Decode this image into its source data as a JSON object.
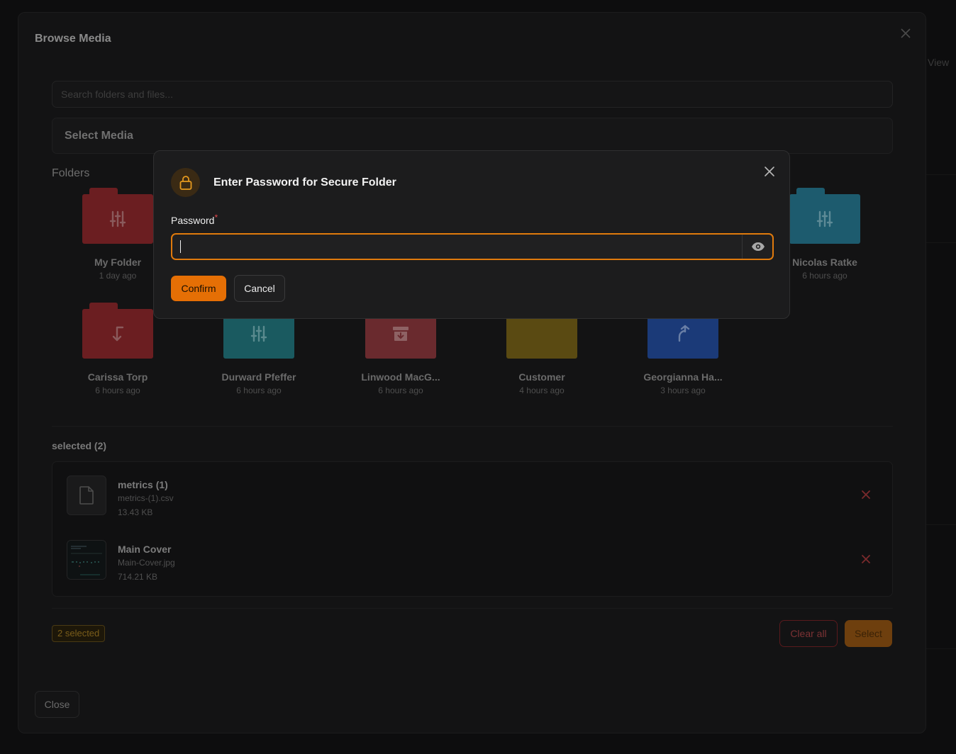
{
  "background": {
    "view_label": "View"
  },
  "outer_modal": {
    "title": "Browse Media",
    "search_placeholder": "Search folders and files...",
    "select_media_title": "Select Media",
    "folders_heading": "Folders"
  },
  "folders": [
    {
      "name": "My Folder",
      "time": "1 day ago",
      "color": "#6b1e21",
      "icon": "sliders-icon"
    },
    {
      "name": "Nicolas Ratke",
      "time": "6 hours ago",
      "color": "#1d5b6e",
      "icon": "sliders-icon"
    },
    {
      "name": "Carissa Torp",
      "time": "6 hours ago",
      "color": "#6b1e21",
      "icon": "arrow-down-left-icon"
    },
    {
      "name": "Durward Pfeffer",
      "time": "6 hours ago",
      "color": "#1a5a60",
      "icon": "sliders-icon"
    },
    {
      "name": "Linwood MacG...",
      "time": "6 hours ago",
      "color": "#6a2a2e",
      "icon": "archive-icon"
    },
    {
      "name": "Customer",
      "time": "4 hours ago",
      "color": "#5a4a12",
      "icon": "none"
    },
    {
      "name": "Georgianna Ha...",
      "time": "3 hours ago",
      "color": "#1b3a78",
      "icon": "arrow-up-right-icon"
    }
  ],
  "selected": {
    "heading": "selected (2)",
    "items": [
      {
        "name": "metrics (1)",
        "file": "metrics-(1).csv",
        "size": "13.43 KB",
        "thumb": "file-icon"
      },
      {
        "name": "Main Cover",
        "file": "Main-Cover.jpg",
        "size": "714.21 KB",
        "thumb": "image-thumbnail"
      }
    ],
    "count_badge": "2 selected",
    "clear_all_label": "Clear all",
    "select_label": "Select"
  },
  "close_label": "Close",
  "password_dialog": {
    "title": "Enter Password for Secure Folder",
    "label": "Password",
    "required_mark": "*",
    "value": "",
    "confirm_label": "Confirm",
    "cancel_label": "Cancel",
    "accent_color": "#e56f05"
  }
}
